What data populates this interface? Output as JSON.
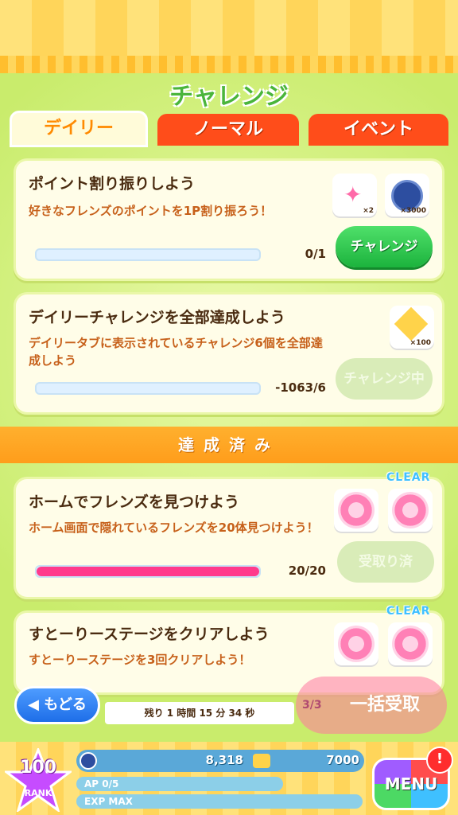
{
  "header": {
    "title": "チャレンジ"
  },
  "tabs": [
    {
      "label": "デイリー",
      "active": true
    },
    {
      "label": "ノーマル",
      "active": false
    },
    {
      "label": "イベント",
      "active": false
    }
  ],
  "challenges": [
    {
      "title": "ポイント割り振りしよう",
      "desc": "好きなフレンズのポイントを1P割り振ろう！",
      "progress_text": "0/1",
      "progress_fraction": 0,
      "button": "チャレンジ",
      "rewards": [
        {
          "icon": "stroller-icon",
          "qty": "×2"
        },
        {
          "icon": "coin-icon",
          "qty": "×3000"
        }
      ]
    },
    {
      "title": "デイリーチャレンジを全部達成しよう",
      "desc": "デイリータブに表示されているチャレンジ6個を全部達成しよう",
      "progress_text": "-1063/6",
      "progress_fraction": 0,
      "button": "チャレンジ中",
      "rewards": [
        {
          "icon": "gem-icon",
          "qty": "×100"
        }
      ]
    }
  ],
  "completed_banner": "達成済み",
  "completed": [
    {
      "badge": "CLEAR",
      "title": "ホームでフレンズを見つけよう",
      "desc": "ホーム画面で隠れているフレンズを20体見つけよう！",
      "progress_text": "20/20",
      "progress_fraction": 1,
      "button": "受取り済"
    },
    {
      "badge": "CLEAR",
      "title": "すとーりーステージをクリアしよう",
      "desc": "すとーりーステージを3回クリアしよう！"
    }
  ],
  "bottom": {
    "back_label": "もどる",
    "timer": "残り 1 時間 15 分 34 秒",
    "bulk_label": "一括受取",
    "bulk_count": "3/3"
  },
  "footer": {
    "rank": "100",
    "rank_label": "RANK",
    "coins": "8,318",
    "gems": "7000",
    "ap": "AP 0/5",
    "exp": "EXP MAX",
    "menu": "MENU",
    "alert": "!"
  }
}
